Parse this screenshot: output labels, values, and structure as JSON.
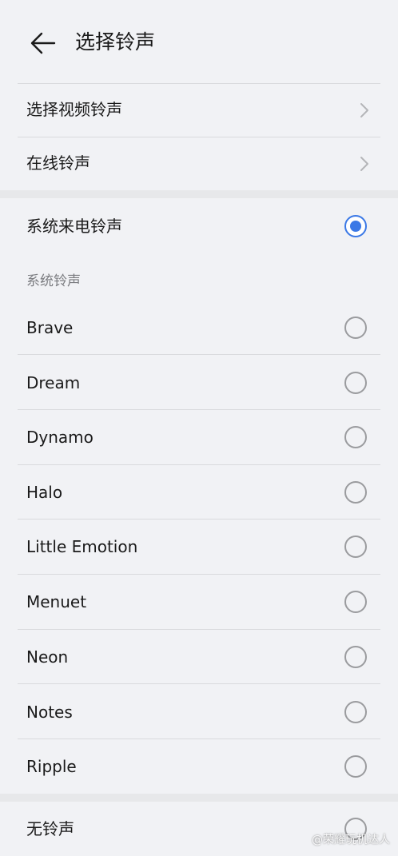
{
  "header": {
    "title": "选择铃声",
    "back_icon": "arrow-left-icon"
  },
  "options": {
    "video_ringtone": "选择视频铃声",
    "online_ringtone": "在线铃声",
    "chevron_icon": "chevron-right-icon"
  },
  "system_incoming": {
    "label": "系统来电铃声",
    "selected": true
  },
  "system_section": {
    "label": "系统铃声",
    "items": [
      {
        "label": "Brave",
        "selected": false
      },
      {
        "label": "Dream",
        "selected": false
      },
      {
        "label": "Dynamo",
        "selected": false
      },
      {
        "label": "Halo",
        "selected": false
      },
      {
        "label": "Little Emotion",
        "selected": false
      },
      {
        "label": "Menuet",
        "selected": false
      },
      {
        "label": "Neon",
        "selected": false
      },
      {
        "label": "Notes",
        "selected": false
      },
      {
        "label": "Ripple",
        "selected": false
      }
    ]
  },
  "no_ringtone": {
    "label": "无铃声",
    "selected": false
  },
  "watermark": "@荣耀玩机达人",
  "colors": {
    "accent": "#3a78e6",
    "background": "#f1f2f5"
  }
}
